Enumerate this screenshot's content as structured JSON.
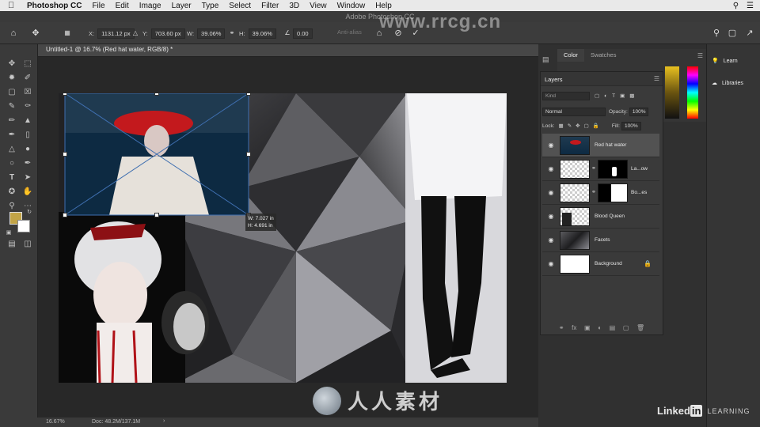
{
  "menubar": {
    "app_name": "Photoshop CC",
    "items": [
      "File",
      "Edit",
      "Image",
      "Layer",
      "Type",
      "Select",
      "Filter",
      "3D",
      "View",
      "Window",
      "Help"
    ]
  },
  "window": {
    "title": "Adobe Photoshop CC"
  },
  "options": {
    "x_label": "X:",
    "x_value": "1131.12 px",
    "y_label": "Y:",
    "y_value": "703.60 px",
    "w_label": "W:",
    "w_value": "39.06%",
    "h_label": "H:",
    "h_value": "39.06%",
    "angle_value": "0.00",
    "antialias_label": "Anti-alias"
  },
  "document": {
    "tab_title": "Untitled-1 @ 16.7% (Red hat water, RGB/8) *",
    "transform_readout_w": "W: 7.027 in",
    "transform_readout_h": "H: 4.691 in"
  },
  "status": {
    "zoom": "16.67%",
    "doc_size": "Doc: 48.2M/137.1M",
    "arrow": "›"
  },
  "panels": {
    "color_tab": "Color",
    "swatches_tab": "Swatches",
    "layers_tab": "Layers",
    "filter_placeholder": "Kind",
    "blend_mode": "Normal",
    "opacity_label": "Opacity:",
    "opacity_value": "100%",
    "lock_label": "Lock:",
    "fill_label": "Fill:",
    "fill_value": "100%",
    "layers": [
      {
        "name": "Red hat water",
        "selected": true
      },
      {
        "name": "La...ow",
        "has_mask": true
      },
      {
        "name": "Bo...es",
        "has_mask": true
      },
      {
        "name": "Blood Queen"
      },
      {
        "name": "Facets"
      },
      {
        "name": "Background",
        "locked": true
      }
    ]
  },
  "learn": {
    "learn_label": "Learn",
    "libraries_label": "Libraries"
  },
  "branding": {
    "linkedin_word": "Linked",
    "linkedin_in": "in",
    "learning": "LEARNING",
    "watermark_top": "www.rrcg.cn",
    "watermark_bottom": "人人素材"
  },
  "colors": {
    "foreground": "#c2a446",
    "background": "#ffffff",
    "panel": "#3a3a3a"
  }
}
